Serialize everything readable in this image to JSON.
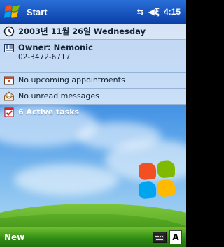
{
  "titlebar": {
    "title": "Start",
    "time": "4:15"
  },
  "today": {
    "date": "2003년 11월 26일 Wednesday",
    "owner_name": "Owner: Nemonic",
    "owner_phone": "02-3472-6717",
    "appointments": "No upcoming appointments",
    "messages": "No unread messages",
    "tasks": "6 Active tasks"
  },
  "bottombar": {
    "new_label": "New",
    "input_mode": "A"
  },
  "colors": {
    "titlebar": "#0b3fa8",
    "bottombar": "#2d8a13"
  }
}
